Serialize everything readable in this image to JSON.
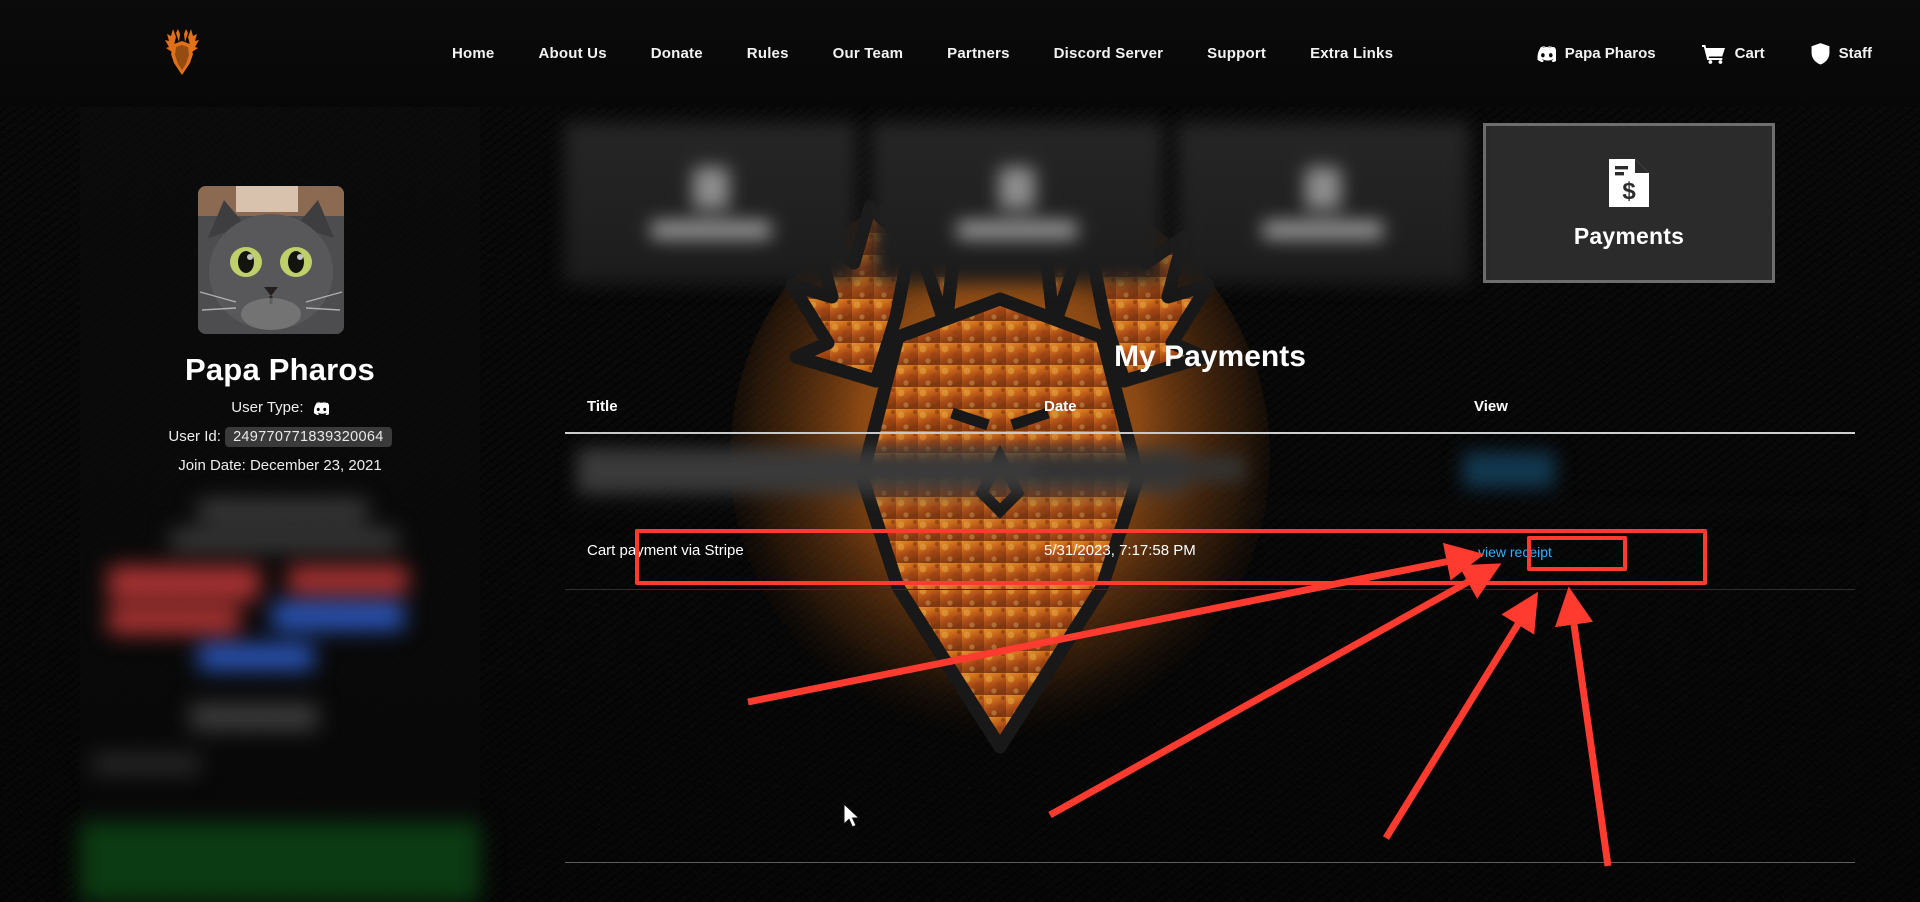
{
  "site": {
    "logo_icon": "stag-head-logo-icon",
    "brand_color": "#e1701a"
  },
  "nav": {
    "links": [
      {
        "label": "Home"
      },
      {
        "label": "About Us"
      },
      {
        "label": "Donate"
      },
      {
        "label": "Rules"
      },
      {
        "label": "Our Team"
      },
      {
        "label": "Partners"
      },
      {
        "label": "Discord Server"
      },
      {
        "label": "Support"
      },
      {
        "label": "Extra Links"
      }
    ],
    "right": [
      {
        "label": "Papa Pharos",
        "icon": "discord-icon"
      },
      {
        "label": "Cart",
        "icon": "cart-icon"
      },
      {
        "label": "Staff",
        "icon": "shield-icon"
      }
    ]
  },
  "profile": {
    "avatar_icon": "user-avatar-cat-photo",
    "name": "Papa Pharos",
    "user_type_label": "User Type:",
    "user_type_icon": "discord-icon",
    "user_id_label": "User Id:",
    "user_id_value": "249770771839320064",
    "join_date": "Join Date: December 23, 2021"
  },
  "cards": [
    {
      "label": "",
      "icon": "user-placeholder-icon",
      "redacted": true
    },
    {
      "label": "",
      "icon": "user-placeholder-icon",
      "redacted": true
    },
    {
      "label": "",
      "icon": "user-placeholder-icon",
      "redacted": true
    },
    {
      "label": "Payments",
      "icon": "invoice-dollar-icon",
      "redacted": false,
      "active": true
    }
  ],
  "main": {
    "heading": "My Payments",
    "watermark_icon": "buck-head-watermark-icon"
  },
  "table": {
    "columns": [
      "Title",
      "Date",
      "View"
    ],
    "rows": [
      {
        "title": "",
        "date": "",
        "view_label": "",
        "redacted": true
      },
      {
        "title": "Cart payment via Stripe",
        "date": "5/31/2023, 7:17:58 PM",
        "view_label": "view receipt",
        "redacted": false,
        "highlighted": true
      }
    ]
  },
  "annotations": {
    "accent_color": "#ff3b30",
    "row_box": "highlight-box-around-payment-row",
    "button_box": "highlight-box-around-view-receipt",
    "arrow_count": 4
  },
  "cursor": {
    "icon": "mouse-pointer-icon"
  }
}
